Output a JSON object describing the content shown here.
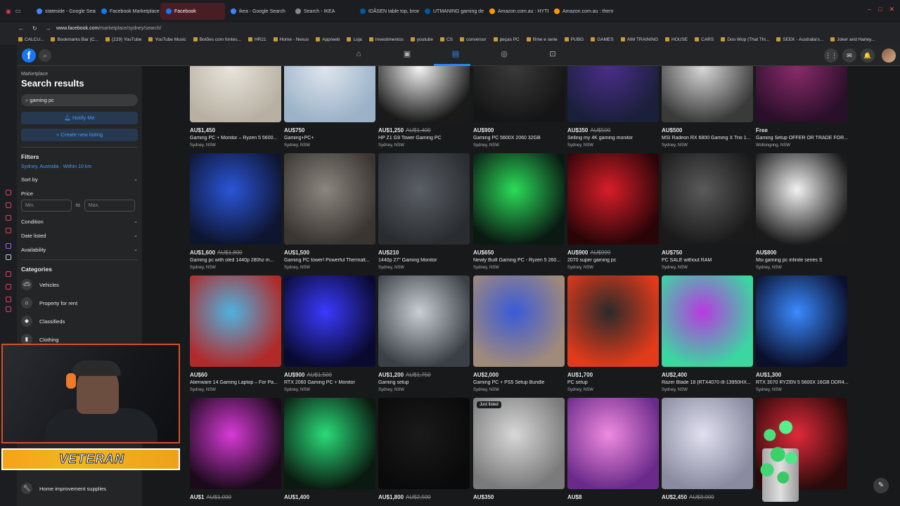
{
  "browser": {
    "tabs": [
      {
        "label": "stateside - Google Search",
        "color": "#4285f4"
      },
      {
        "label": "Facebook Marketplace | Fa",
        "color": "#1877f2"
      },
      {
        "label": "Facebook",
        "color": "#1877f2",
        "active": true
      },
      {
        "label": "ikea - Google Search",
        "color": "#4285f4"
      },
      {
        "label": "Search - IKEA",
        "color": "#888888"
      },
      {
        "label": "IDÅSEN table top, brown,",
        "color": "#0058a3"
      },
      {
        "label": "UTMANING gaming desk",
        "color": "#0058a3"
      },
      {
        "label": "Amazon.com.au : HYTE H",
        "color": "#ff9900"
      },
      {
        "label": "Amazon.com.au : thermalt",
        "color": "#ff9900"
      }
    ],
    "url_host": "www.facebook.com",
    "url_path": "/marketplace/sydney/search/",
    "bookmarks": [
      "CALCU...",
      "Bookmarks Bar (C...",
      "(229) YouTube",
      "YouTube Music",
      "Botões com fontes...",
      "HR21",
      "Home - Nexus",
      "App/web",
      "Loja",
      "Investimentos",
      "youtube",
      "CS",
      "conversor",
      "peças PC",
      "filme e serie",
      "PUBG",
      "GAMES",
      "AIM TRAINING",
      "HOUSE",
      "CARS",
      "Doo Wop (That Thi...",
      "SEEK - Australia's...",
      "Joker and Harley..."
    ]
  },
  "sidebar": {
    "crumb": "Marketplace",
    "title": "Search results",
    "search_value": "gaming pc",
    "notify_label": "Notify Me",
    "create_label": "Create new listing",
    "filters_title": "Filters",
    "location": "Sydney, Australia · Within 10 km",
    "sort_label": "Sort by",
    "price_label": "Price",
    "min_placeholder": "Min.",
    "to_label": "to",
    "max_placeholder": "Max.",
    "condition_label": "Condition",
    "date_label": "Date listed",
    "availability_label": "Availability",
    "categories_title": "Categories",
    "categories": [
      "Vehicles",
      "Property for rent",
      "Classifieds",
      "Clothing"
    ],
    "bottom_category": "Home improvement supplies"
  },
  "overlay": {
    "banner_text": "VETERAN"
  },
  "listings": [
    {
      "price": "AU$1,450",
      "old": "",
      "title": "Gaming PC + Monitor – Ryzen 5 5600...",
      "loc": "Sydney, NSW",
      "c1": "#e9e5dc",
      "c2": "#b8b1a3"
    },
    {
      "price": "AU$750",
      "old": "",
      "title": "Gaming+PC+",
      "loc": "Sydney, NSW",
      "c1": "#dfe6ee",
      "c2": "#9bb2c8"
    },
    {
      "price": "AU$1,250",
      "old": "AU$1,400",
      "title": "HP Z1 G9 Tower Gaming PC",
      "loc": "Sydney, NSW",
      "c1": "#f4f4f4",
      "c2": "#1a1a1a"
    },
    {
      "price": "AU$900",
      "old": "",
      "title": "Gaming PC 5600X 2060 32GB",
      "loc": "Sydney, NSW",
      "c1": "#3a3a3a",
      "c2": "#151515"
    },
    {
      "price": "AU$350",
      "old": "AU$500",
      "title": "Selling my 4K gaming monitor",
      "loc": "Sydney, NSW",
      "c1": "#4a2d8a",
      "c2": "#1a1f3a"
    },
    {
      "price": "AU$500",
      "old": "",
      "title": "MSI Radeon RX 6800 Gaming X Trio 1...",
      "loc": "Sydney, NSW",
      "c1": "#d8d8d8",
      "c2": "#3a3a3a"
    },
    {
      "price": "Free",
      "old": "",
      "title": "Gaming Setup OFFER OR TRADE FOR...",
      "loc": "Wollongong, NSW",
      "c1": "#8a2b6a",
      "c2": "#2a0f2a"
    },
    {
      "price": "AU$1,600",
      "old": "AU$1,800",
      "title": "Gaming pc with oled 1440p 280hz m...",
      "loc": "Sydney, NSW",
      "c1": "#2a55d8",
      "c2": "#0e1530"
    },
    {
      "price": "AU$1,500",
      "old": "",
      "title": "Gaming PC tower! Powerful Thermalt...",
      "loc": "Sydney, NSW",
      "c1": "#8a8680",
      "c2": "#3a3530"
    },
    {
      "price": "AU$210",
      "old": "",
      "title": "1440p 27\" Gaming Monitor",
      "loc": "Sydney, NSW",
      "c1": "#5a5f66",
      "c2": "#2a2d30"
    },
    {
      "price": "AU$650",
      "old": "",
      "title": "Newly Built Gaming PC - Ryzen 5 260...",
      "loc": "Sydney, NSW",
      "c1": "#2bdc5a",
      "c2": "#0a1a12"
    },
    {
      "price": "AU$900",
      "old": "AU$999",
      "title": "2070 super gaming pc",
      "loc": "Sydney, NSW",
      "c1": "#d81e2a",
      "c2": "#2a0508"
    },
    {
      "price": "AU$750",
      "old": "",
      "title": "PC SALE without RAM",
      "loc": "Sydney, NSW",
      "c1": "#5a5a5a",
      "c2": "#1a1a1a"
    },
    {
      "price": "AU$800",
      "old": "",
      "title": "Msi gaming pc infinite series S",
      "loc": "Sydney, NSW",
      "c1": "#f2f2f2",
      "c2": "#1a1a1a"
    },
    {
      "price": "AU$60",
      "old": "",
      "title": "Alienware 14 Gaming Laptop – For Pa...",
      "loc": "Sydney, NSW",
      "c1": "#4fb3e0",
      "c2": "#b02a2a"
    },
    {
      "price": "AU$900",
      "old": "AU$1,500",
      "title": "RTX 2060 Gaming PC + Monitor",
      "loc": "Sydney, NSW",
      "c1": "#3a3aff",
      "c2": "#0a0a30"
    },
    {
      "price": "AU$1,200",
      "old": "AU$1,750",
      "title": "Gaming setup",
      "loc": "Sydney, NSW",
      "c1": "#c9ced4",
      "c2": "#3a4046"
    },
    {
      "price": "AU$2,000",
      "old": "",
      "title": "Gaming PC + PS5 Setup Bundle",
      "loc": "Sydney, NSW",
      "c1": "#3a5ad8",
      "c2": "#a08a7a"
    },
    {
      "price": "AU$1,700",
      "old": "",
      "title": "PC setup",
      "loc": "Sydney, NSW",
      "c1": "#2a2a2a",
      "c2": "#e23a1a"
    },
    {
      "price": "AU$2,400",
      "old": "",
      "title": "Razer Blade 18 (RTX4070 i9-13950HX...",
      "loc": "Sydney, NSW",
      "c1": "#b83ae0",
      "c2": "#3ad8a0"
    },
    {
      "price": "AU$1,300",
      "old": "",
      "title": "RTX 3070 RYZEN 5 5600X 16GB DDR4...",
      "loc": "Sydney, NSW",
      "c1": "#3a8aff",
      "c2": "#0a0f2a"
    },
    {
      "price": "AU$1",
      "old": "AU$1,000",
      "title": "",
      "loc": "",
      "c1": "#d83ad8",
      "c2": "#1a0a1a"
    },
    {
      "price": "AU$1,400",
      "old": "",
      "title": "",
      "loc": "",
      "c1": "#2adc7a",
      "c2": "#0a1a10"
    },
    {
      "price": "AU$1,800",
      "old": "AU$2,500",
      "title": "",
      "loc": "",
      "c1": "#1a1a1a",
      "c2": "#0a0a0a"
    },
    {
      "price": "AU$350",
      "old": "",
      "title": "",
      "loc": "",
      "c1": "#d8d8d8",
      "c2": "#7a7a7a",
      "badge": "Just listed"
    },
    {
      "price": "AU$8",
      "old": "",
      "title": "",
      "loc": "",
      "c1": "#f08ae0",
      "c2": "#6a2a8a"
    },
    {
      "price": "AU$2,450",
      "old": "AU$3,000",
      "title": "",
      "loc": "",
      "c1": "#e0e0f0",
      "c2": "#8a8aa0"
    },
    {
      "price": "",
      "old": "",
      "title": "",
      "loc": "",
      "c1": "#e02a3a",
      "c2": "#2a0a0a"
    }
  ]
}
